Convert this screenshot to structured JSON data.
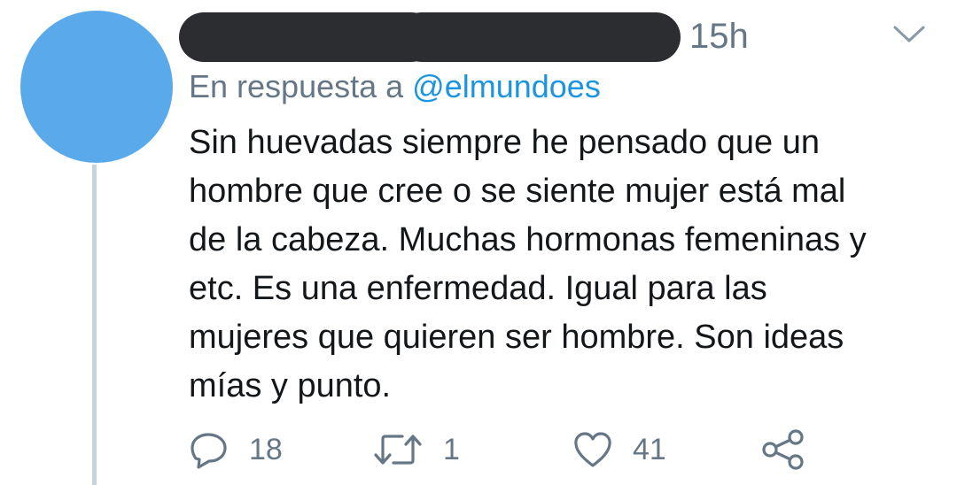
{
  "tweet": {
    "timestamp": "15h",
    "reply_to": {
      "prefix": "En respuesta a",
      "mention": "@elmundoes"
    },
    "text_lines": [
      "Sin huevadas siempre he pensado que un",
      "hombre que cree o se siente mujer está mal",
      "de la cabeza. Muchas hormonas femeninas y",
      "etc. Es una enfermedad. Igual para las",
      "mujeres que quieren ser hombre. Son ideas",
      "mías y punto."
    ]
  },
  "actions": {
    "reply_count": "18",
    "retweet_count": "1",
    "like_count": "41"
  },
  "icons": {
    "avatar": "avatar-placeholder",
    "menu": "chevron-down-icon",
    "reply": "reply-icon",
    "retweet": "retweet-icon",
    "like": "heart-icon",
    "share": "share-icon"
  },
  "colors": {
    "avatar": "#5aaaeb",
    "redaction": "#2b2d30",
    "secondary_text": "#657786",
    "mention": "#1b95e0",
    "thread_line": "#c9d3dc"
  }
}
